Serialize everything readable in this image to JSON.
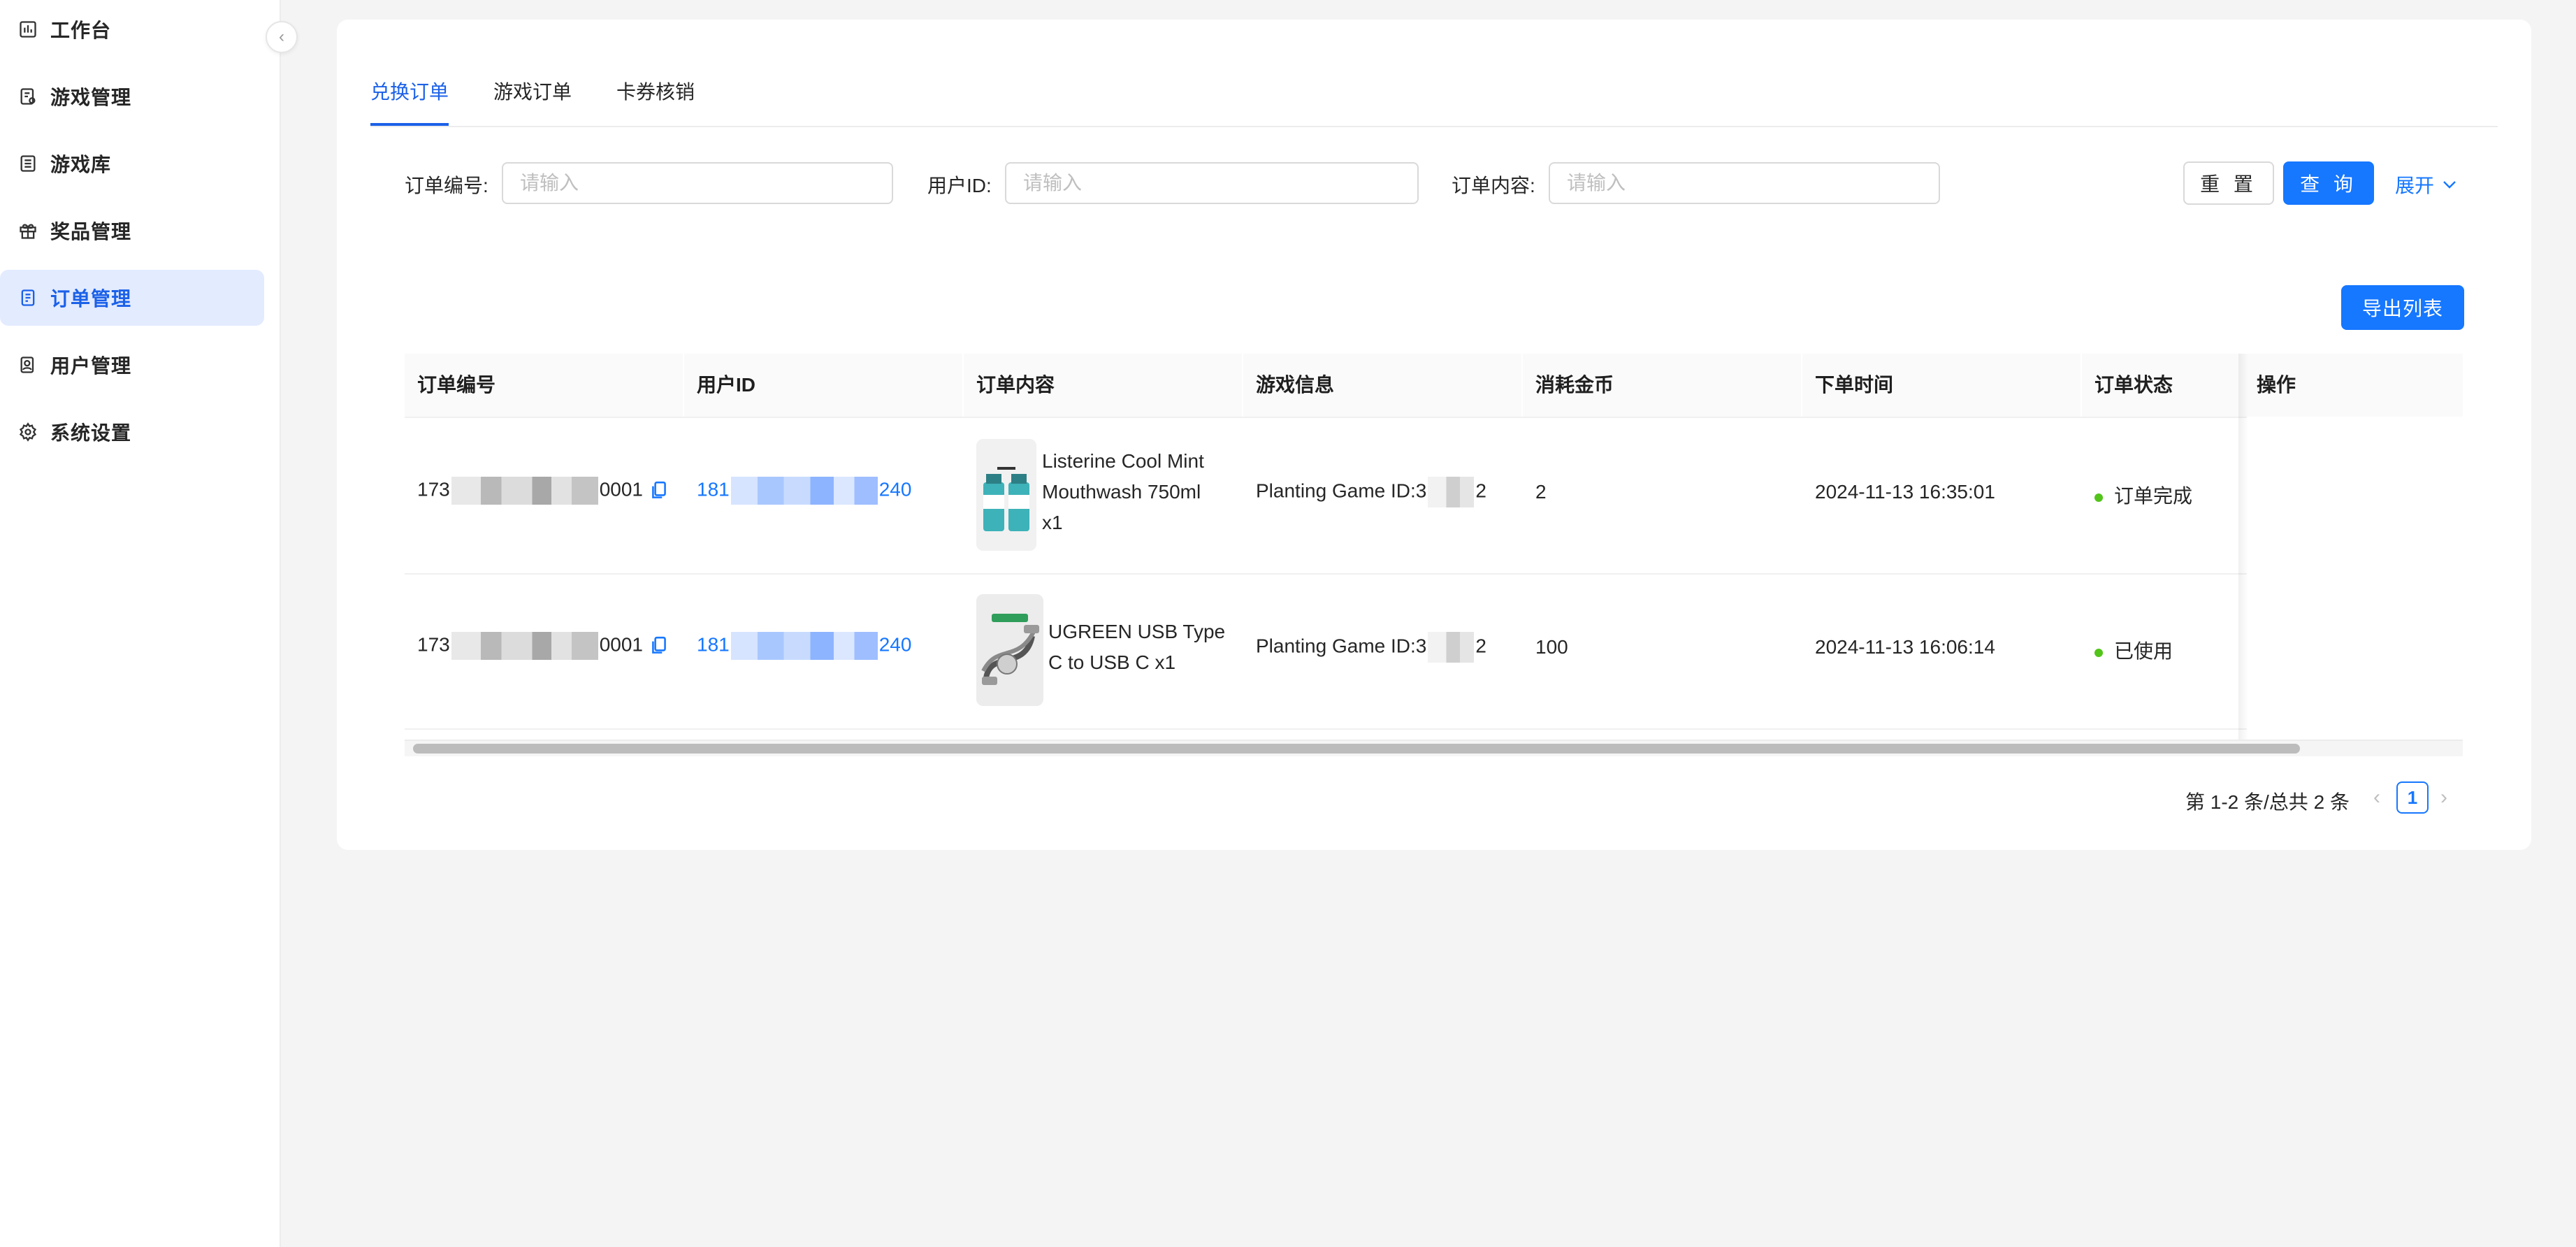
{
  "sidebar": {
    "items": [
      {
        "label": "工作台",
        "icon": "dashboard-icon",
        "active": false
      },
      {
        "label": "游戏管理",
        "icon": "game-manage-icon",
        "active": false
      },
      {
        "label": "游戏库",
        "icon": "library-icon",
        "active": false
      },
      {
        "label": "奖品管理",
        "icon": "gift-icon",
        "active": false
      },
      {
        "label": "订单管理",
        "icon": "order-icon",
        "active": true
      },
      {
        "label": "用户管理",
        "icon": "user-icon",
        "active": false
      },
      {
        "label": "系统设置",
        "icon": "gear-icon",
        "active": false
      }
    ],
    "collapse_glyph": "‹"
  },
  "tabs": [
    {
      "label": "兑换订单",
      "active": true
    },
    {
      "label": "游戏订单",
      "active": false
    },
    {
      "label": "卡券核销",
      "active": false
    }
  ],
  "search": {
    "order_no_label": "订单编号:",
    "order_no_placeholder": "请输入",
    "user_id_label": "用户ID:",
    "user_id_placeholder": "请输入",
    "content_label": "订单内容:",
    "content_placeholder": "请输入",
    "reset_label": "重 置",
    "query_label": "查 询",
    "expand_label": "展开"
  },
  "export_label": "导出列表",
  "table": {
    "columns": [
      "订单编号",
      "用户ID",
      "订单内容",
      "游戏信息",
      "消耗金币",
      "下单时间",
      "订单状态",
      "操作"
    ],
    "rows": [
      {
        "order_prefix": "173",
        "order_suffix": "0001",
        "user_prefix": "181",
        "user_suffix": "240",
        "goods_lines": [
          "Listerine Cool Mint",
          "Mouthwash 750ml",
          "x1"
        ],
        "game_text": "Planting Game  ID:3",
        "game_suffix": "2",
        "coins": "2",
        "time": "2024-11-13 16:35:01",
        "status": "订单完成"
      },
      {
        "order_prefix": "173",
        "order_suffix": "0001",
        "user_prefix": "181",
        "user_suffix": "240",
        "goods_lines": [
          "UGREEN USB Type",
          "C to USB C x1"
        ],
        "game_text": "Planting Game  ID:3",
        "game_suffix": "2",
        "coins": "100",
        "time": "2024-11-13 16:06:14",
        "status": "已使用"
      }
    ]
  },
  "pagination": {
    "total_text": "第 1-2 条/总共 2 条",
    "prev": "‹",
    "current": "1",
    "next": "›"
  },
  "colors": {
    "primary": "#1677ff",
    "active_nav_bg": "#e3ebff",
    "status_green": "#52c41a"
  }
}
